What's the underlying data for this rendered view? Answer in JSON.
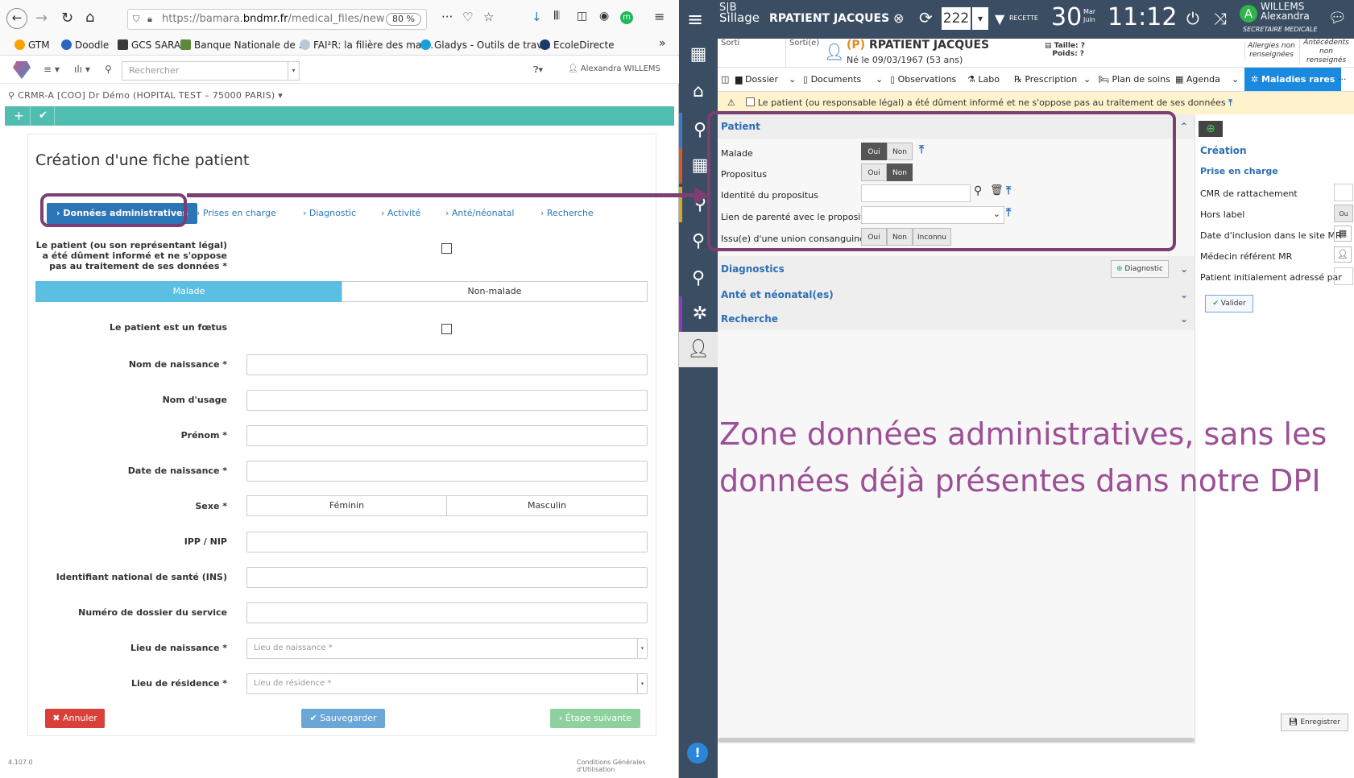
{
  "browser": {
    "url_prefix": "https://bamara.",
    "url_domain": "bndmr.fr",
    "url_path": "/medical_files/new",
    "zoom": "80 %",
    "bookmarks": [
      "GTM",
      "Doodle",
      "GCS SARA",
      "Banque Nationale de ...",
      "FAI²R: la filière des mal...",
      "Gladys - Outils de trav...",
      "EcoleDirecte"
    ],
    "overflow": "»"
  },
  "app": {
    "search_placeholder": "Rechercher",
    "user": "Alexandra WILLEMS",
    "breadcrumb": "CRMR-A [COO] Dr Démo (HOPITAL TEST – 75000 PARIS)",
    "form_title": "Création d'une fiche patient",
    "steps": [
      "Données administratives",
      "Prises en charge",
      "Diagnostic",
      "Activité",
      "Anté/néonatal",
      "Recherche"
    ],
    "consent_label": "Le patient (ou son représentant légal) a été dûment informé et ne s'oppose pas au traitement de ses données *",
    "toggle_malade": "Malade",
    "toggle_non_malade": "Non-malade",
    "foetus_label": "Le patient est un fœtus",
    "fields": [
      {
        "label": "Nom de naissance *",
        "placeholder": ""
      },
      {
        "label": "Nom d'usage",
        "placeholder": ""
      },
      {
        "label": "Prénom *",
        "placeholder": ""
      },
      {
        "label": "Date de naissance *",
        "placeholder": ""
      },
      {
        "label": "Sexe *",
        "placeholder": ""
      },
      {
        "label": "IPP / NIP",
        "placeholder": ""
      },
      {
        "label": "Identifiant national de santé (INS)",
        "placeholder": ""
      },
      {
        "label": "Numéro de dossier du service",
        "placeholder": ""
      },
      {
        "label": "Lieu de naissance *",
        "placeholder": "Lieu de naissance *"
      },
      {
        "label": "Lieu de résidence *",
        "placeholder": "Lieu de résidence *"
      }
    ],
    "sex_options": [
      "Féminin",
      "Masculin"
    ],
    "btn_cancel": "Annuler",
    "btn_save": "Sauvegarder",
    "btn_next": "Étape suivante",
    "version": "4.107.0",
    "cgu": "Conditions Générales d'Utilisation"
  },
  "sillage": {
    "logo_top": "S|B",
    "logo_bottom": "Sillage",
    "patient_top": "RPATIENT JACQUES",
    "counter": "222",
    "env": "RECETTE",
    "day": "30",
    "day_name": "Mar",
    "month": "Juin",
    "time": "11:12",
    "user_last": "WILLEMS",
    "user_first": "Alexandra",
    "user_role": "SECRETAIRE MEDICALE",
    "avatar_letter": "A",
    "sorti": "Sorti",
    "sortie": "Sorti(e)",
    "prefix": "(P)",
    "patient_name": "RPATIENT JACQUES",
    "birth": "Né le 09/03/1967 (53 ans)",
    "taille": "Taille: ?",
    "poids": "Poids: ?",
    "allergies": "Allergies non renseignées",
    "antecedents": "Antécédents non renseignés",
    "tabs": [
      "Dossier",
      "Documents",
      "Observations",
      "Labo",
      "Prescription",
      "Plan de soins",
      "Agenda",
      "Maladies rares"
    ],
    "warning": "Le patient (ou responsable légal) a été dûment informé et ne s'oppose pas au traitement de ses données",
    "sec_patient": "Patient",
    "row_malade": "Malade",
    "row_propositus": "Propositus",
    "row_identite": "Identité du propositus",
    "row_lien": "Lien de parenté avec le propositus",
    "row_union": "Issu(e) d'une union consanguine",
    "oui": "Oui",
    "non": "Non",
    "inconnu": "Inconnu",
    "sec_diag": "Diagnostics",
    "btn_diag": "Diagnostic",
    "sec_ante": "Anté et néonatal(es)",
    "sec_rech": "Recherche",
    "rp_creation": "Création",
    "rp_prise": "Prise en charge",
    "rp_cmr": "CMR de rattachement",
    "rp_hors": "Hors label",
    "rp_date": "Date d'inclusion dans le site MR",
    "rp_medecin": "Médecin référent MR",
    "rp_adresse": "Patient initialement adressé par",
    "rp_ou": "Ou",
    "btn_valider": "Valider",
    "btn_enregistrer": "Enregistrer"
  },
  "annotation": "Zone données administratives, sans les données déjà présentes dans notre DPI",
  "colors": {
    "teal": "#4fbdb0",
    "blue": "#2c76b7",
    "sillage": "#3b4d63",
    "annotation": "#7b3f72"
  }
}
